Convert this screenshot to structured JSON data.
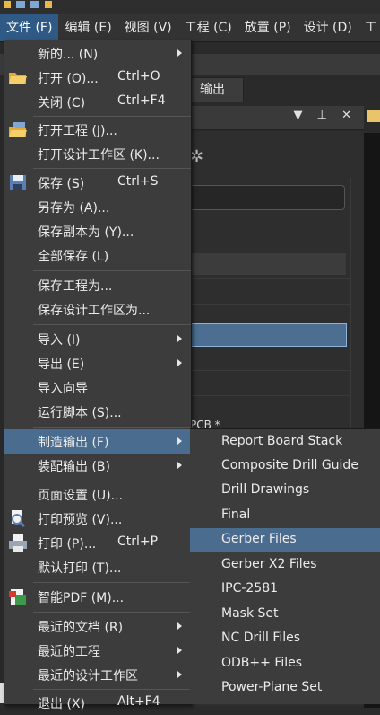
{
  "menubar": {
    "items": [
      "文件 (F)",
      "编辑 (E)",
      "视图 (V)",
      "工程 (C)",
      "放置 (P)",
      "设计 (D)",
      "工"
    ]
  },
  "background": {
    "tab_output": "输出",
    "pcb_label": "PCB *"
  },
  "file_menu": {
    "items": [
      {
        "label": "新的... (N)",
        "shortcut": "",
        "submenu": true,
        "icon": ""
      },
      {
        "label": "打开 (O)...",
        "shortcut": "Ctrl+O",
        "submenu": false,
        "icon": "open-folder-icon"
      },
      {
        "label": "关闭 (C)",
        "shortcut": "Ctrl+F4",
        "submenu": false,
        "icon": ""
      },
      {
        "label": "打开工程 (J)...",
        "shortcut": "",
        "submenu": false,
        "icon": "open-project-icon"
      },
      {
        "label": "打开设计工作区 (K)...",
        "shortcut": "",
        "submenu": false,
        "icon": ""
      },
      {
        "label": "保存 (S)",
        "shortcut": "Ctrl+S",
        "submenu": false,
        "icon": "save-disk-icon"
      },
      {
        "label": "另存为 (A)...",
        "shortcut": "",
        "submenu": false,
        "icon": ""
      },
      {
        "label": "保存副本为 (Y)...",
        "shortcut": "",
        "submenu": false,
        "icon": ""
      },
      {
        "label": "全部保存 (L)",
        "shortcut": "",
        "submenu": false,
        "icon": ""
      },
      {
        "label": "保存工程为...",
        "shortcut": "",
        "submenu": false,
        "icon": ""
      },
      {
        "label": "保存设计工作区为...",
        "shortcut": "",
        "submenu": false,
        "icon": ""
      },
      {
        "label": "导入 (I)",
        "shortcut": "",
        "submenu": true,
        "icon": ""
      },
      {
        "label": "导出 (E)",
        "shortcut": "",
        "submenu": true,
        "icon": ""
      },
      {
        "label": "导入向导",
        "shortcut": "",
        "submenu": false,
        "icon": ""
      },
      {
        "label": "运行脚本 (S)...",
        "shortcut": "",
        "submenu": false,
        "icon": ""
      },
      {
        "label": "制造输出 (F)",
        "shortcut": "",
        "submenu": true,
        "icon": ""
      },
      {
        "label": "装配输出 (B)",
        "shortcut": "",
        "submenu": true,
        "icon": ""
      },
      {
        "label": "页面设置 (U)...",
        "shortcut": "",
        "submenu": false,
        "icon": ""
      },
      {
        "label": "打印预览 (V)...",
        "shortcut": "",
        "submenu": false,
        "icon": "print-preview-icon"
      },
      {
        "label": "打印 (P)...",
        "shortcut": "Ctrl+P",
        "submenu": false,
        "icon": "printer-icon"
      },
      {
        "label": "默认打印 (T)...",
        "shortcut": "",
        "submenu": false,
        "icon": ""
      },
      {
        "label": "智能PDF (M)...",
        "shortcut": "",
        "submenu": false,
        "icon": "smart-pdf-icon"
      },
      {
        "label": "最近的文档 (R)",
        "shortcut": "",
        "submenu": true,
        "icon": ""
      },
      {
        "label": "最近的工程",
        "shortcut": "",
        "submenu": true,
        "icon": ""
      },
      {
        "label": "最近的设计工作区",
        "shortcut": "",
        "submenu": true,
        "icon": ""
      },
      {
        "label": "退出 (X)",
        "shortcut": "Alt+F4",
        "submenu": false,
        "icon": ""
      }
    ]
  },
  "fab_submenu": {
    "items": [
      "Report Board Stack",
      "Composite Drill Guide",
      "Drill Drawings",
      "Final",
      "Gerber Files",
      "Gerber X2 Files",
      "IPC-2581",
      "Mask Set",
      "NC Drill Files",
      "ODB++ Files",
      "Power-Plane Set"
    ]
  },
  "colors": {
    "menu_bg": "#3c3c3c",
    "highlight": "#4a6c8e",
    "menubar_active": "#2f5a86"
  }
}
